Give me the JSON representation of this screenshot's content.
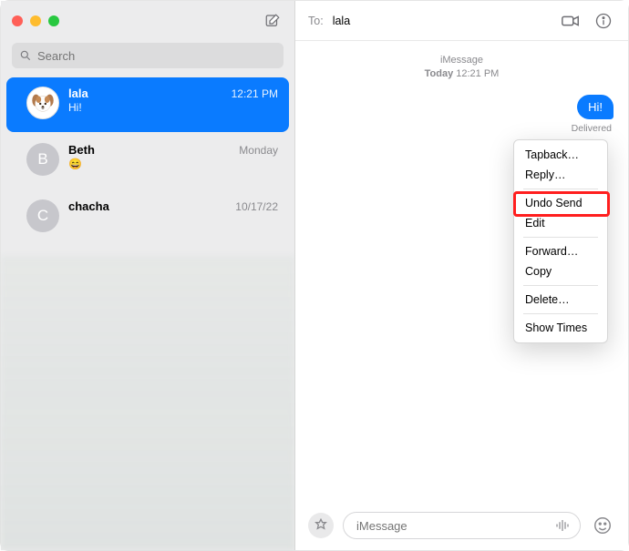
{
  "sidebar": {
    "search_placeholder": "Search",
    "conversations": [
      {
        "name": "lala",
        "time": "12:21 PM",
        "preview": "Hi!",
        "avatar_kind": "dog",
        "selected": true
      },
      {
        "name": "Beth",
        "time": "Monday",
        "preview": "😄",
        "avatar_kind": "initial",
        "initial": "B",
        "selected": false
      },
      {
        "name": "chacha",
        "time": "10/17/22",
        "preview": " ",
        "avatar_kind": "initial",
        "initial": "C",
        "selected": false
      }
    ]
  },
  "conversation": {
    "to_label": "To:",
    "to_name": "lala",
    "meta_service": "iMessage",
    "meta_day": "Today",
    "meta_time": "12:21 PM",
    "bubble_text": "Hi!",
    "delivered_label": "Delivered",
    "input_placeholder": "iMessage"
  },
  "context_menu": {
    "items": [
      "Tapback…",
      "Reply…",
      "Undo Send",
      "Edit",
      "Forward…",
      "Copy",
      "Delete…",
      "Show Times"
    ],
    "highlighted_index": 2
  }
}
